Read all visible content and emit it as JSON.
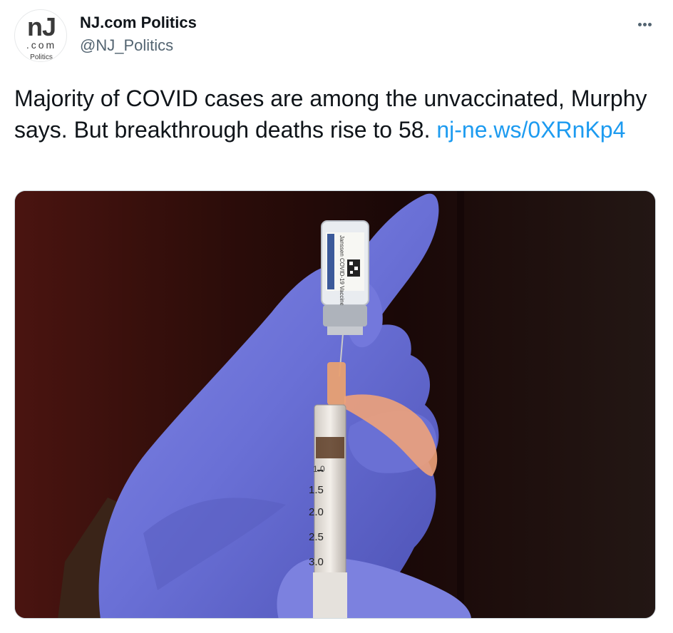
{
  "author": {
    "display_name": "NJ.com Politics",
    "handle": "@NJ_Politics",
    "avatar": {
      "logo_main": "nJ",
      "logo_sub": ".com",
      "logo_caption": "Politics"
    }
  },
  "tweet": {
    "text": "Majority of COVID cases are among the unvaccinated, Murphy says. But breakthrough deaths rise to 58. ",
    "link": "nj-ne.ws/0XRnKp4"
  },
  "media": {
    "vial_label": "Janssen COVID-19 Vaccine",
    "syringe_marks": [
      "1.0",
      "1.5",
      "2.0",
      "2.5",
      "3.0"
    ]
  },
  "colors": {
    "link": "#1d9bf0",
    "glove": "#6f74d8",
    "secondary_text": "#536471"
  },
  "icons": {
    "more": "more-icon"
  }
}
